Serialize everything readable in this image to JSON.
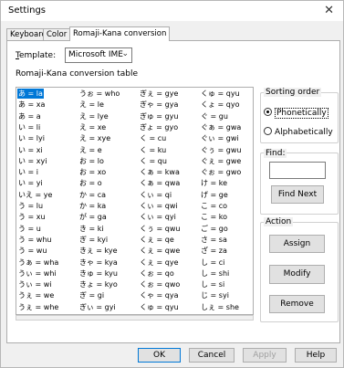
{
  "window": {
    "title": "Settings",
    "close_icon": "close-icon"
  },
  "tabs": [
    {
      "label": "Keyboard"
    },
    {
      "label": "Color"
    },
    {
      "label": "Romaji-Kana conversion",
      "active": true
    }
  ],
  "template": {
    "label_prefix": "T",
    "label_rest": "emplate:",
    "selected": "Microsoft IME"
  },
  "table_label": "Romaji-Kana conversion table",
  "table": {
    "columns": [
      [
        "あ = la",
        "あ = xa",
        "あ = a",
        "い = li",
        "い = lyi",
        "い = xi",
        "い = xyi",
        "い = i",
        "い = yi",
        "いえ = ye",
        "う = lu",
        "う = xu",
        "う = u",
        "う = whu",
        "う = wu",
        "うぁ = wha",
        "うぃ = whi",
        "うぃ = wi",
        "うぇ = we",
        "うぇ = whe"
      ],
      [
        "うぉ = who",
        "え = le",
        "え = lye",
        "え = xe",
        "え = xye",
        "え = e",
        "お = lo",
        "お = xo",
        "お = o",
        "か = ca",
        "か = ka",
        "が = ga",
        "き = ki",
        "ぎ = kyi",
        "きぇ = kye",
        "きゃ = kya",
        "きゅ = kyu",
        "きょ = kyo",
        "ぎ = gi",
        "ぎぃ = gyi"
      ],
      [
        "ぎぇ = gye",
        "ぎゃ = gya",
        "ぎゅ = gyu",
        "ぎょ = gyo",
        "く = cu",
        "く = ku",
        "く = qu",
        "くぁ = kwa",
        "くぁ = qwa",
        "くぃ = qi",
        "くぃ = qwi",
        "くぃ = qyi",
        "くぅ = qwu",
        "くぇ = qe",
        "くぇ = qwe",
        "くぇ = qye",
        "くぉ = qo",
        "くぉ = qwo",
        "くゃ = qya",
        "くゅ = qyu"
      ],
      [
        "くゅ = qyu",
        "くょ = qyo",
        "ぐ = gu",
        "ぐぁ = gwa",
        "ぐぃ = gwi",
        "ぐぅ = gwu",
        "ぐぇ = gwe",
        "ぐぉ = gwo",
        "け = ke",
        "げ = ge",
        "こ = co",
        "こ = ko",
        "ご = go",
        "さ = sa",
        "ざ = za",
        "し = ci",
        "し = shi",
        "し = si",
        "じ = syi",
        "しぇ = she"
      ]
    ],
    "selected_row": 0,
    "selected_col": 0
  },
  "sorting": {
    "label": "Sorting order",
    "options": [
      {
        "label": "Phonetically",
        "checked": true
      },
      {
        "label": "Alphabetically",
        "checked": false
      }
    ]
  },
  "find": {
    "label": "Find:",
    "value": "",
    "button": "Find Next"
  },
  "action": {
    "label": "Action",
    "buttons": [
      "Assign",
      "Modify",
      "Remove"
    ]
  },
  "footer": {
    "ok": "OK",
    "cancel": "Cancel",
    "apply": "Apply",
    "help": "Help"
  }
}
